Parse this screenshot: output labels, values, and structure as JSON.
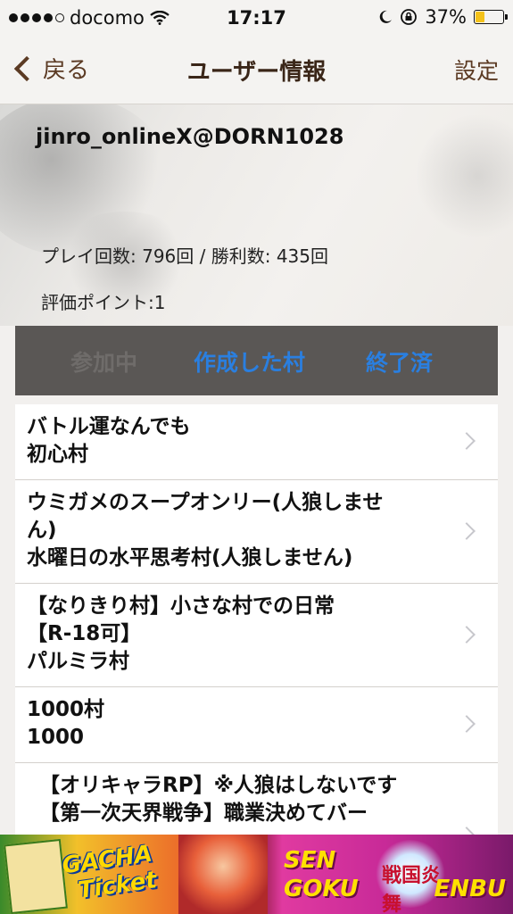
{
  "status_bar": {
    "carrier": "docomo",
    "time": "17:17",
    "battery_percent": "37%",
    "battery_level": 0.37,
    "icons": [
      "signal-dots-icon",
      "wifi-icon",
      "moon-icon",
      "rotation-lock-icon",
      "battery-icon"
    ]
  },
  "nav": {
    "back_label": "戻る",
    "title": "ユーザー情報",
    "settings_label": "設定"
  },
  "profile": {
    "username": "jinro_onlineX@DORN1028",
    "stats": "プレイ回数: 796回 / 勝利数: 435回",
    "points": "評価ポイント:1"
  },
  "segments": [
    {
      "label": "参加中",
      "state": "disabled"
    },
    {
      "label": "作成した村",
      "state": "active"
    },
    {
      "label": "終了済",
      "state": "active"
    }
  ],
  "villages": [
    {
      "lines": [
        "バトル運なんでも",
        "初心村"
      ]
    },
    {
      "lines": [
        "ウミガメのスープオンリー(人狼しませ",
        "ん)",
        "水曜日の水平思考村(人狼しません)"
      ]
    },
    {
      "lines": [
        "【なりきり村】小さな村での日常",
        "【R-18可】",
        "パルミラ村"
      ]
    },
    {
      "lines": [
        "1000村",
        "1000"
      ]
    },
    {
      "lines": [
        "【オリキャラRP】※人狼はしないです",
        "【第一次天界戦争】職業決めてバー"
      ]
    }
  ],
  "ad": {
    "gacha_line1": "GACHA",
    "gacha_line2": "Ticket",
    "sen": "SEN",
    "goku": "GOKU",
    "logo_text": "戦国炎舞",
    "enbu": "ENBU"
  },
  "colors": {
    "accent_brown": "#5b3a23",
    "segment_bg": "#5a5755",
    "segment_active": "#2a7fe0",
    "segment_disabled": "#6f6c6a",
    "battery_fill": "#f4c21a"
  }
}
